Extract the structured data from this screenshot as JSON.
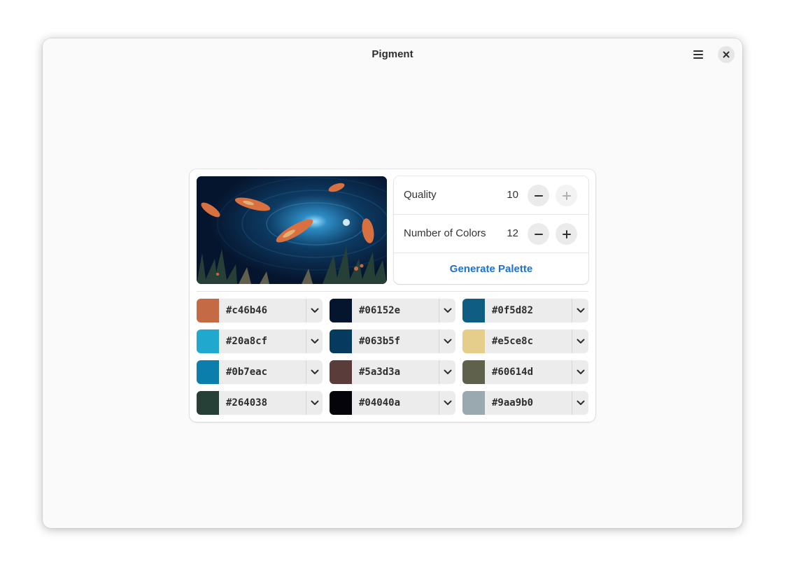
{
  "window": {
    "title": "Pigment"
  },
  "controls": {
    "quality": {
      "label": "Quality",
      "value": "10"
    },
    "colors": {
      "label": "Number of Colors",
      "value": "12"
    },
    "generate_label": "Generate Palette"
  },
  "palette": [
    {
      "hex": "#c46b46",
      "color": "#c46b46"
    },
    {
      "hex": "#06152e",
      "color": "#06152e"
    },
    {
      "hex": "#0f5d82",
      "color": "#0f5d82"
    },
    {
      "hex": "#20a8cf",
      "color": "#20a8cf"
    },
    {
      "hex": "#063b5f",
      "color": "#063b5f"
    },
    {
      "hex": "#e5ce8c",
      "color": "#e5ce8c"
    },
    {
      "hex": "#0b7eac",
      "color": "#0b7eac"
    },
    {
      "hex": "#5a3d3a",
      "color": "#5a3d3a"
    },
    {
      "hex": "#60614d",
      "color": "#60614d"
    },
    {
      "hex": "#264038",
      "color": "#264038"
    },
    {
      "hex": "#04040a",
      "color": "#04040a"
    },
    {
      "hex": "#9aa9b0",
      "color": "#9aa9b0"
    }
  ],
  "icons": {
    "menu": "hamburger-menu-icon",
    "close": "close-icon",
    "minus": "minus-icon",
    "plus": "plus-icon",
    "dropdown": "chevron-down-icon"
  },
  "colors": {
    "accent": "#1c71d8",
    "window_bg": "#fafafa"
  }
}
